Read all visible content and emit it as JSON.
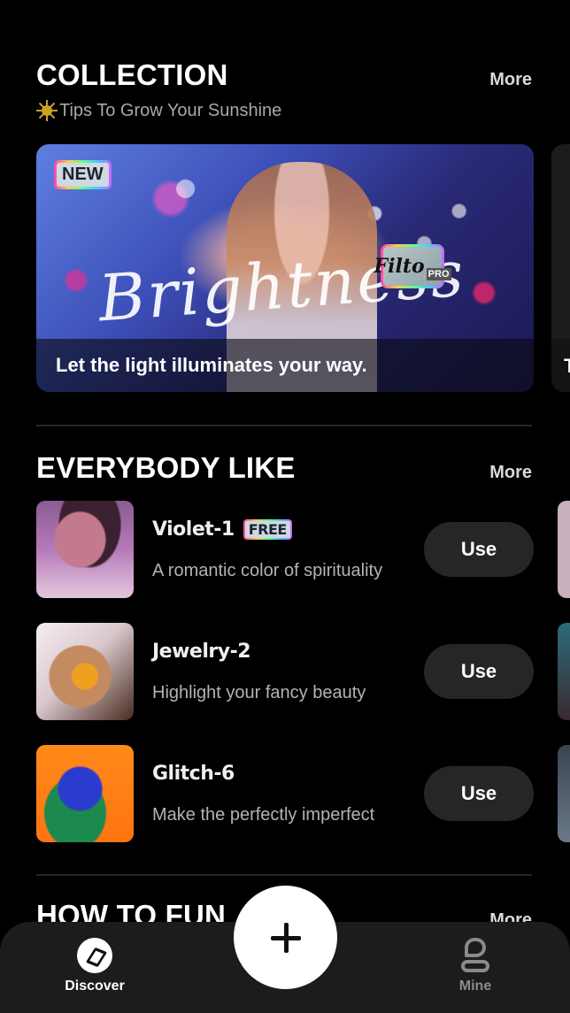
{
  "collection": {
    "title": "COLLECTION",
    "more_label": "More",
    "subtitle": "Tips To Grow Your Sunshine",
    "subtitle_icon": "sun-icon",
    "banner": {
      "badge": "NEW",
      "script_title": "Brightness",
      "brand_badge": "Filto",
      "brand_badge_tier": "PRO",
      "caption": "Let the light illuminates your way."
    },
    "next_card_caption_initial": "T"
  },
  "everybody_like": {
    "title": "EVERYBODY LIKE",
    "more_label": "More",
    "items": [
      {
        "name": "Violet-1",
        "badge": "FREE",
        "description": "A romantic color of spirituality",
        "button": "Use"
      },
      {
        "name": "Jewelry-2",
        "badge": null,
        "description": "Highlight your fancy beauty",
        "button": "Use"
      },
      {
        "name": "Glitch-6",
        "badge": null,
        "description": "Make the perfectly imperfect",
        "button": "Use"
      }
    ]
  },
  "how_to_fun": {
    "title": "HOW TO FUN",
    "more_label": "More"
  },
  "tabbar": {
    "tabs": [
      {
        "label": "Discover",
        "icon": "compass-icon",
        "active": true
      },
      {
        "label": "Mine",
        "icon": "person-icon",
        "active": false
      }
    ],
    "fab_icon": "plus-icon"
  }
}
